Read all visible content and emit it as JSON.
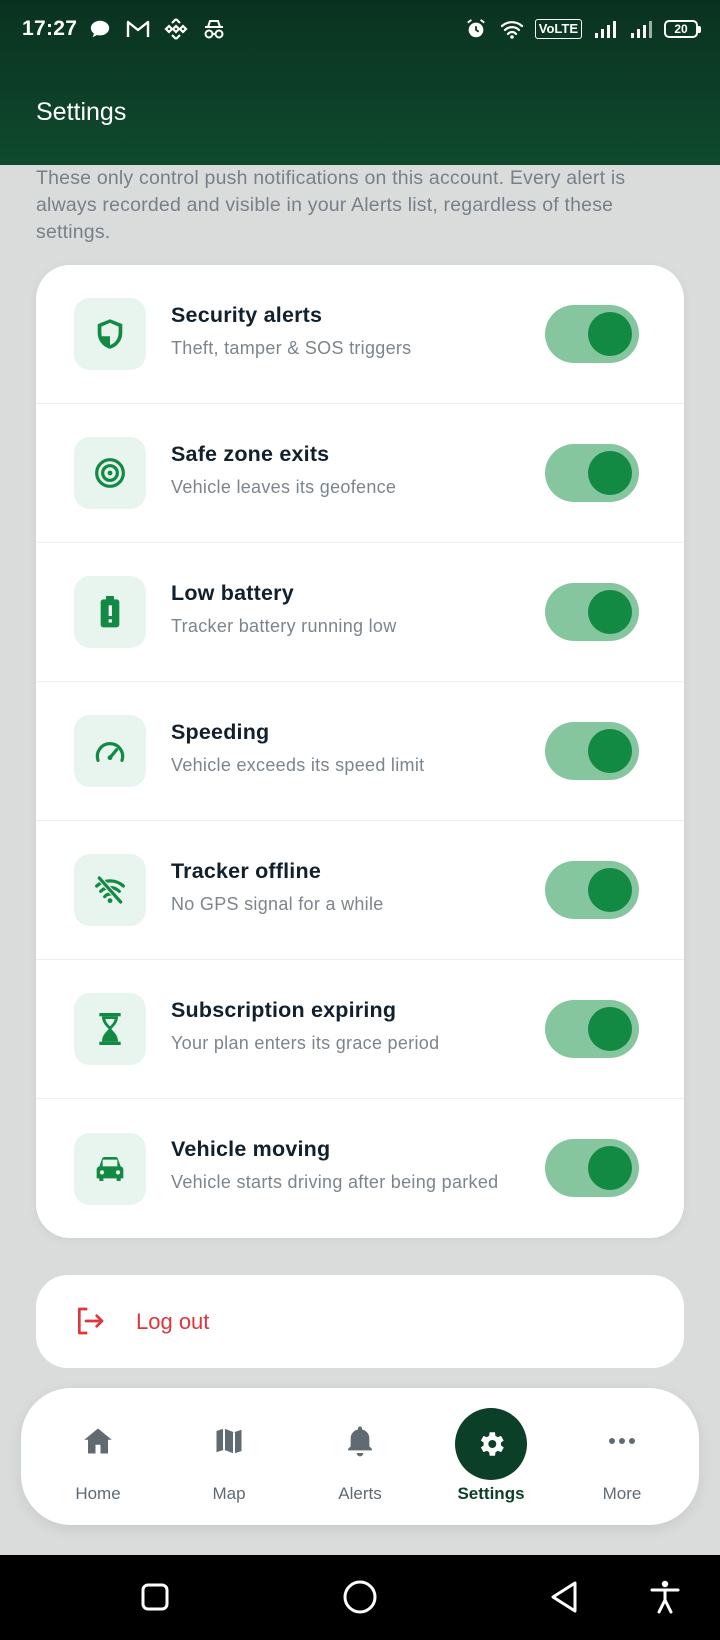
{
  "statusbar": {
    "time": "17:27",
    "left_icons": [
      "chat-bubble-icon",
      "gmail-icon",
      "binance-icon",
      "incognito-icon"
    ],
    "right_icons": [
      "alarm-icon",
      "wifi-icon",
      "volte-badge",
      "signal-icon",
      "signal-icon"
    ],
    "volte_label": "VoLTE",
    "battery_level": "20"
  },
  "header": {
    "title": "Settings"
  },
  "intro_text": "These only control push notifications on this account. Every alert is always recorded and visible in your Alerts list, regardless of these settings.",
  "notifications": [
    {
      "title": "Security alerts",
      "subtitle": "Theft, tamper & SOS triggers",
      "icon": "shield-icon",
      "enabled": true
    },
    {
      "title": "Safe zone exits",
      "subtitle": "Vehicle leaves its geofence",
      "icon": "target-icon",
      "enabled": true
    },
    {
      "title": "Low battery",
      "subtitle": "Tracker battery running low",
      "icon": "battery-alert-icon",
      "enabled": true
    },
    {
      "title": "Speeding",
      "subtitle": "Vehicle exceeds its speed limit",
      "icon": "speedometer-icon",
      "enabled": true
    },
    {
      "title": "Tracker offline",
      "subtitle": "No GPS signal for a while",
      "icon": "wifi-off-icon",
      "enabled": true
    },
    {
      "title": "Subscription expiring",
      "subtitle": "Your plan enters its grace period",
      "icon": "hourglass-icon",
      "enabled": true
    },
    {
      "title": "Vehicle moving",
      "subtitle": "Vehicle starts driving after being parked",
      "icon": "car-icon",
      "enabled": true
    }
  ],
  "logout": {
    "label": "Log out",
    "icon": "logout-icon"
  },
  "bottom_nav": [
    {
      "label": "Home",
      "icon": "home-icon",
      "active": false
    },
    {
      "label": "Map",
      "icon": "map-icon",
      "active": false
    },
    {
      "label": "Alerts",
      "icon": "bell-icon",
      "active": false
    },
    {
      "label": "Settings",
      "icon": "gear-icon",
      "active": true
    },
    {
      "label": "More",
      "icon": "more-dots-icon",
      "active": false
    }
  ],
  "colors": {
    "header_bg": "#0f4a2e",
    "accent_green": "#138a43",
    "toggle_track": "#86c69f",
    "icon_tile_bg": "#e8f4ee",
    "logout_red": "#e0353b",
    "active_nav_bg": "#0c3f27"
  }
}
